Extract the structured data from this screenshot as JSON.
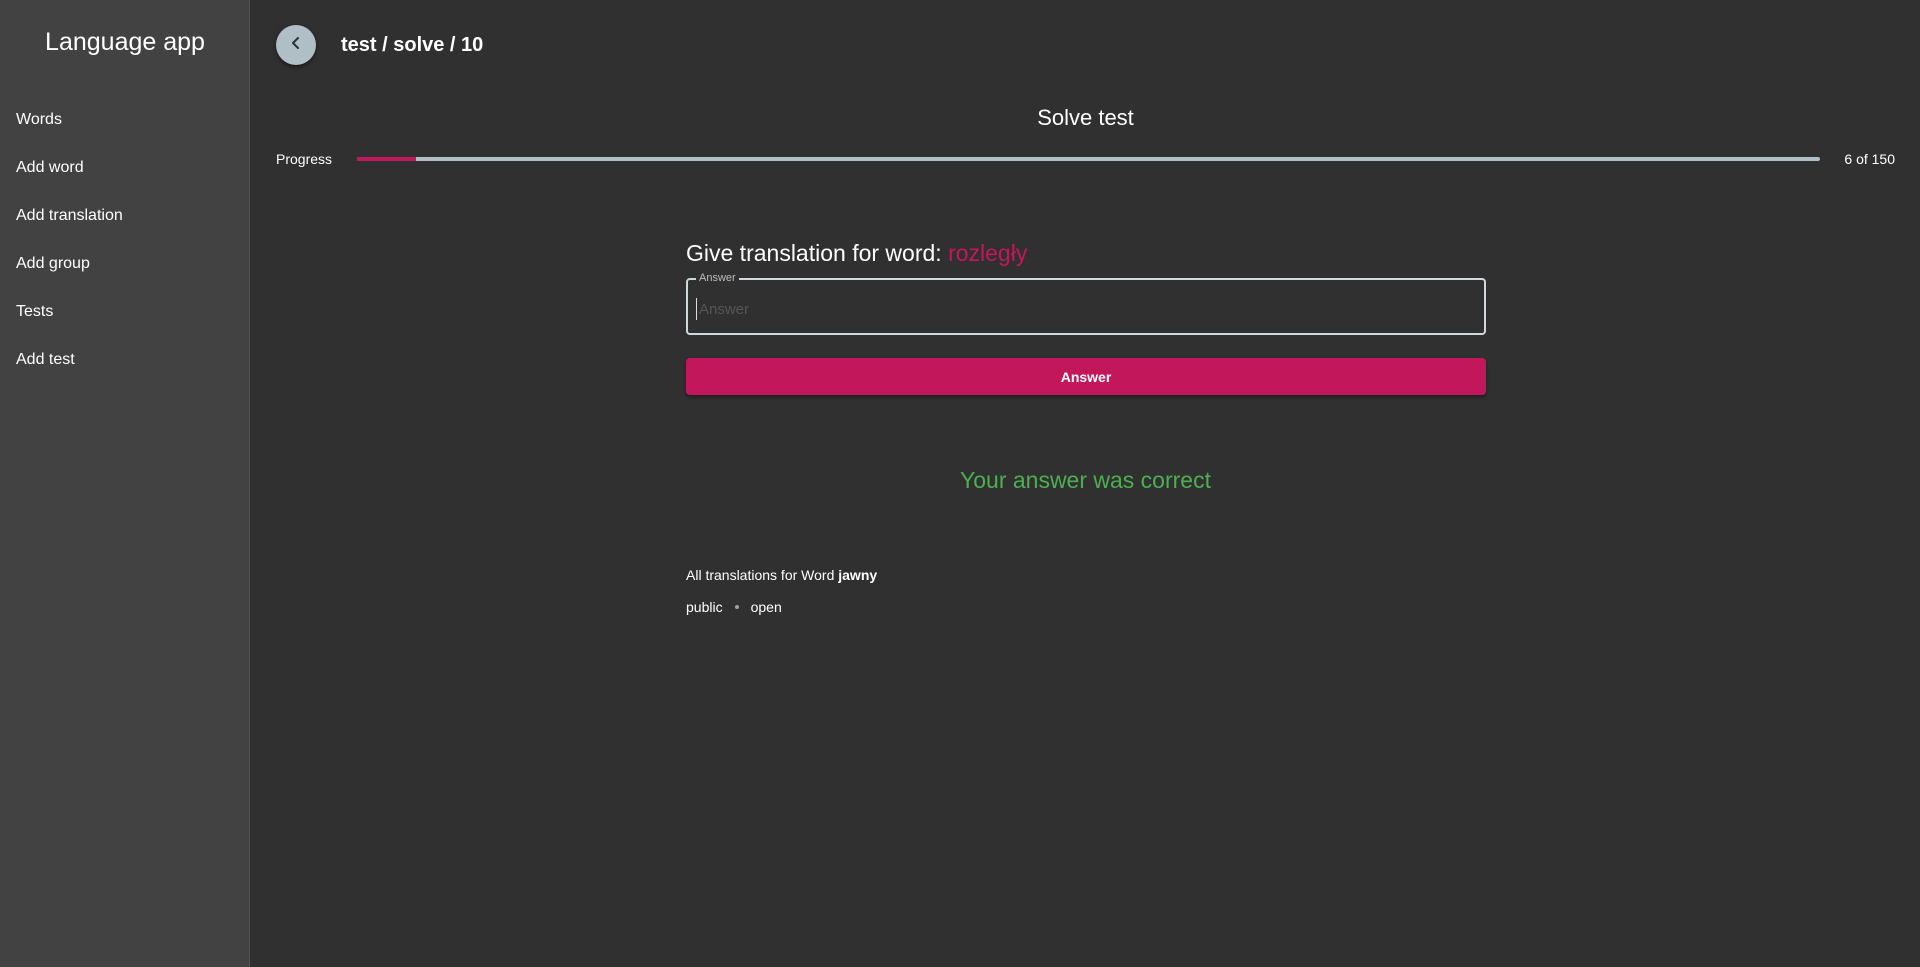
{
  "sidebar": {
    "title": "Language app",
    "items": [
      {
        "label": "Words"
      },
      {
        "label": "Add word"
      },
      {
        "label": "Add translation"
      },
      {
        "label": "Add group"
      },
      {
        "label": "Tests"
      },
      {
        "label": "Add test"
      }
    ]
  },
  "header": {
    "back_icon": "chevron-left-icon",
    "breadcrumb": "test / solve / 10"
  },
  "main": {
    "heading": "Solve test",
    "progress": {
      "label": "Progress",
      "current": 6,
      "total": 150,
      "fraction": 0.04,
      "text": "6 of 150",
      "fill_color": "#c2185b",
      "track_color": "#b0bec5"
    },
    "question": {
      "prefix": "Give translation for word: ",
      "word": "rozległy",
      "word_color": "#c2185b"
    },
    "answer_field": {
      "label": "Answer",
      "placeholder": "Answer",
      "value": ""
    },
    "answer_button": "Answer",
    "accent_color": "#c2185b",
    "feedback": {
      "text": "Your answer was correct",
      "color": "#4caf50"
    },
    "translations": {
      "heading_prefix": "All translations for Word ",
      "word": "jawny",
      "items": [
        "public",
        "open"
      ]
    }
  }
}
